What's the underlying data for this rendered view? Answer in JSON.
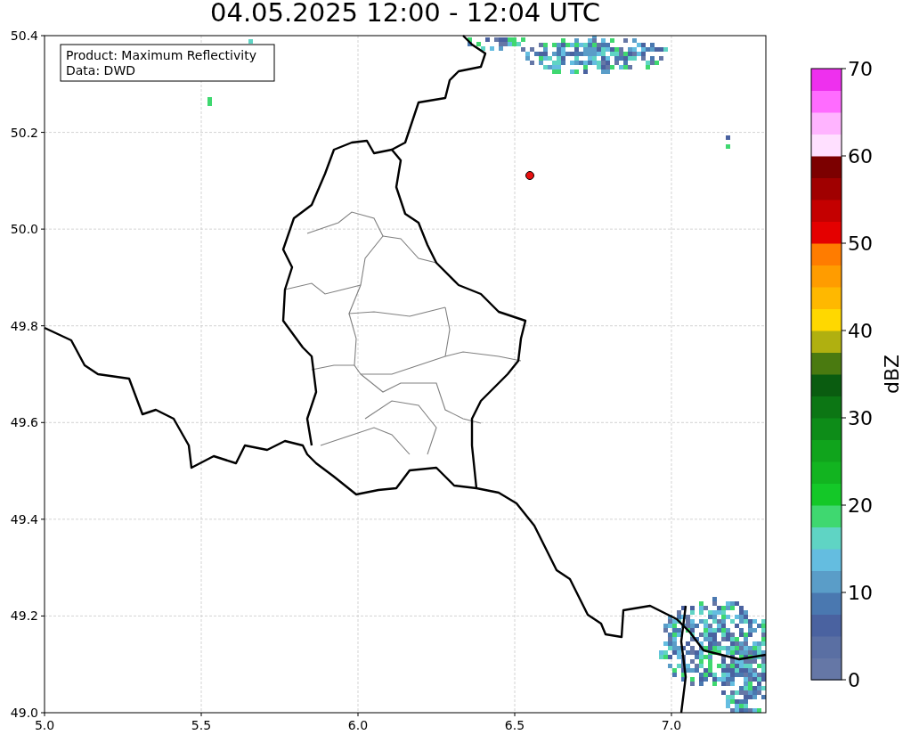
{
  "title": "04.05.2025 12:00 - 12:04 UTC",
  "map": {
    "info_lines": [
      "Product: Maximum Reflectivity",
      "Data: DWD"
    ],
    "xticks": [
      "5.0",
      "5.5",
      "6.0",
      "6.5",
      "7.0"
    ],
    "yticks": [
      "50.4",
      "50.2",
      "50.0",
      "49.8",
      "49.6",
      "49.4",
      "49.2",
      "49.0"
    ]
  },
  "colorbar": {
    "label": "dBZ",
    "ticks": [
      "70",
      "60",
      "50",
      "40",
      "30",
      "20",
      "10",
      "0"
    ],
    "bins": [
      {
        "color": "#6577a6"
      },
      {
        "color": "#5a6fa3"
      },
      {
        "color": "#4a62a0"
      },
      {
        "color": "#4a78b0"
      },
      {
        "color": "#5a9dc8"
      },
      {
        "color": "#64bde0"
      },
      {
        "color": "#5fd4c4"
      },
      {
        "color": "#3fd870"
      },
      {
        "color": "#14c828"
      },
      {
        "color": "#12b420"
      },
      {
        "color": "#10a41c"
      },
      {
        "color": "#0d8c18"
      },
      {
        "color": "#0c7614"
      },
      {
        "color": "#0a5c10"
      },
      {
        "color": "#4a7a10"
      },
      {
        "color": "#b0b010"
      },
      {
        "color": "#ffd800"
      },
      {
        "color": "#ffb800"
      },
      {
        "color": "#ff9c00"
      },
      {
        "color": "#ff7c00"
      },
      {
        "color": "#e40000"
      },
      {
        "color": "#c40000"
      },
      {
        "color": "#a00000"
      },
      {
        "color": "#7c0000"
      },
      {
        "color": "#ffe0ff"
      },
      {
        "color": "#ffb4ff"
      },
      {
        "color": "#ff6cff"
      },
      {
        "color": "#ee30ee"
      }
    ]
  }
}
